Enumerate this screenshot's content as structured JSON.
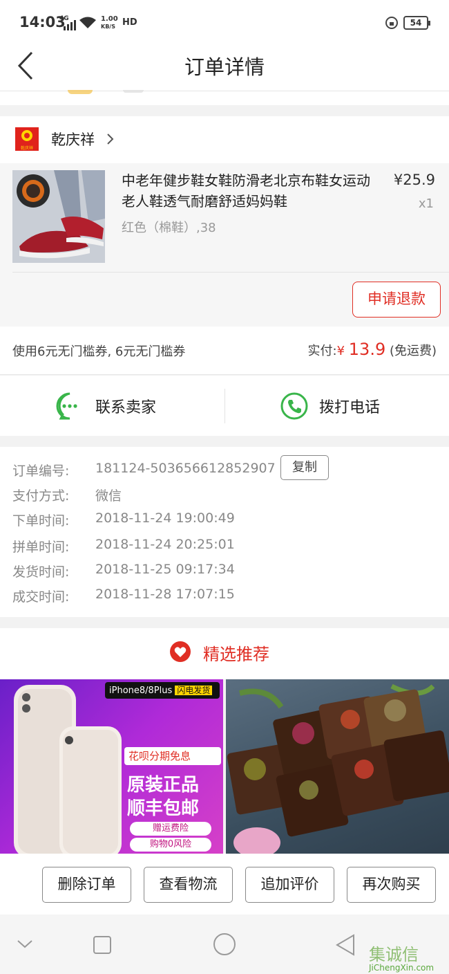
{
  "status_bar": {
    "time": "14:03",
    "network": "4G",
    "speed": "1.00",
    "speed_unit": "KB/S",
    "hd": "HD",
    "battery": "54"
  },
  "header": {
    "title": "订单详情"
  },
  "shop": {
    "name": "乾庆祥",
    "logo_text": "乾庆祥"
  },
  "product": {
    "title": "中老年健步鞋女鞋防滑老北京布鞋女运动老人鞋透气耐磨舒适妈妈鞋",
    "price": "¥25.9",
    "quantity": "x1",
    "sku": "红色（棉鞋）,38",
    "refund_label": "申请退款"
  },
  "payment": {
    "coupon_text": "使用6元无门槛券, 6元无门槛券",
    "paid_label": "实付:",
    "currency": "¥",
    "paid_amount": "13.9",
    "shipping_note": "(免运费)"
  },
  "contact": {
    "seller_label": "联系卖家",
    "call_label": "拨打电话"
  },
  "order_info": {
    "rows": [
      {
        "label": "订单编号:",
        "value": "181124-503656612852907"
      },
      {
        "label": "支付方式:",
        "value": "微信"
      },
      {
        "label": "下单时间:",
        "value": "2018-11-24 19:00:49"
      },
      {
        "label": "拼单时间:",
        "value": "2018-11-24 20:25:01"
      },
      {
        "label": "发货时间:",
        "value": "2018-11-25 09:17:34"
      },
      {
        "label": "成交时间:",
        "value": "2018-11-28 17:07:15"
      }
    ],
    "copy_label": "复制"
  },
  "recommend": {
    "title": "精选推荐",
    "item1": {
      "tag": "iPhone8/8Plus",
      "tag2": "闪电发货",
      "badge": "花呗分期免息",
      "line1": "原装正品",
      "line2": "顺丰包邮",
      "chip1": "赠运费险",
      "chip2": "购物0风险"
    }
  },
  "actions": {
    "delete": "删除订单",
    "logistics": "查看物流",
    "review": "追加评价",
    "rebuy": "再次购买"
  },
  "watermark": {
    "text": "JiChengXin.com",
    "chars": "集诚信"
  },
  "colors": {
    "accent": "#e02e24",
    "green": "#39b54a"
  }
}
